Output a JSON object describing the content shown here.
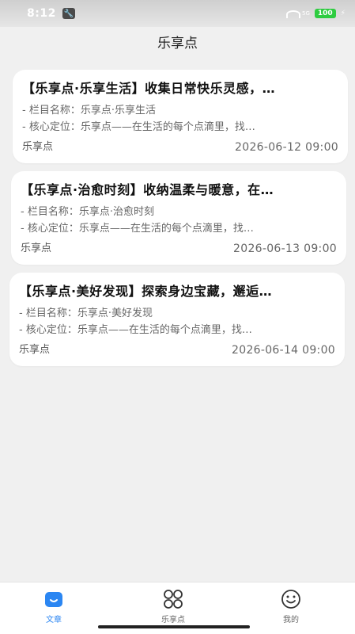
{
  "status": {
    "time": "8:12",
    "network": "5G",
    "battery": "100"
  },
  "header": {
    "title": "乐享点"
  },
  "articles": [
    {
      "title": "【乐享点·乐享生活】收集日常快乐灵感，…",
      "line1": "- 栏目名称：乐享点·乐享生活",
      "line2": "- 核心定位：乐享点——在生活的每个点滴里，找…",
      "source": "乐享点",
      "date": "2026-06-12 09:00"
    },
    {
      "title": "【乐享点·治愈时刻】收纳温柔与暖意，在…",
      "line1": "- 栏目名称：乐享点·治愈时刻",
      "line2": "- 核心定位：乐享点——在生活的每个点滴里，找…",
      "source": "乐享点",
      "date": "2026-06-13 09:00"
    },
    {
      "title": "【乐享点·美好发现】探索身边宝藏，邂逅…",
      "line1": "- 栏目名称：乐享点·美好发现",
      "line2": "- 核心定位：乐享点——在生活的每个点滴里，找…",
      "source": "乐享点",
      "date": "2026-06-14 09:00"
    }
  ],
  "tabs": [
    {
      "label": "文章",
      "icon": "article-icon",
      "active": true
    },
    {
      "label": "乐享点",
      "icon": "grid-icon",
      "active": false
    },
    {
      "label": "我的",
      "icon": "smiley-icon",
      "active": false
    }
  ],
  "colors": {
    "accent": "#2b86f2",
    "background": "#f0f0f0",
    "card": "#ffffff"
  }
}
